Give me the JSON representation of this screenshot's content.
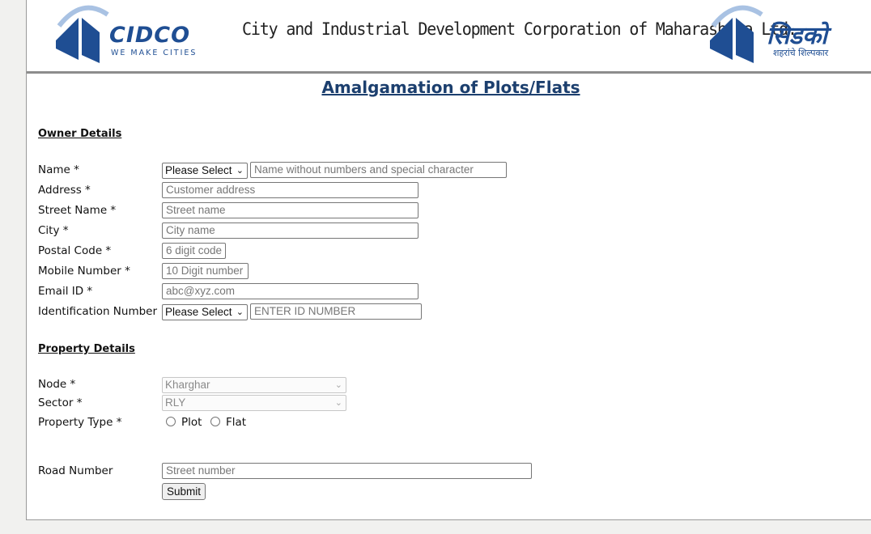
{
  "header": {
    "logo_left": {
      "word": "CIDCO",
      "tagline": "WE MAKE CITIES"
    },
    "corporation_name": "City and Industrial Development Corporation of Maharashtra Ltd.",
    "logo_right": {
      "word": "सिडको",
      "tagline": "शहरांचे शिल्पकार"
    }
  },
  "title": "Amalgamation of Plots/Flats",
  "owner_section": {
    "heading": "Owner Details",
    "name": {
      "label": "Name *",
      "title_select": "Please Select",
      "placeholder": "Name without numbers and special character"
    },
    "address": {
      "label": "Address *",
      "placeholder": "Customer address"
    },
    "street": {
      "label": "Street Name *",
      "placeholder": "Street name"
    },
    "city": {
      "label": "City *",
      "placeholder": "City name"
    },
    "postal": {
      "label": "Postal Code *",
      "placeholder": "6 digit code"
    },
    "mobile": {
      "label": "Mobile Number *",
      "placeholder": "10 Digit number"
    },
    "email": {
      "label": "Email ID *",
      "placeholder": "abc@xyz.com"
    },
    "id_number": {
      "label": "Identification Number",
      "type_select": "Please Select",
      "placeholder": "ENTER ID NUMBER"
    }
  },
  "property_section": {
    "heading": "Property Details",
    "node": {
      "label": "Node *",
      "value": "Kharghar"
    },
    "sector": {
      "label": "Sector *",
      "value": "RLY"
    },
    "property_type": {
      "label": "Property Type *",
      "options": [
        "Plot",
        "Flat"
      ]
    },
    "road": {
      "label": "Road Number",
      "placeholder": "Street number"
    }
  },
  "submit_label": "Submit",
  "colors": {
    "brand_blue": "#1f4e93",
    "title_blue": "#1c3f6e",
    "header_rule": "#8c8c8c"
  }
}
